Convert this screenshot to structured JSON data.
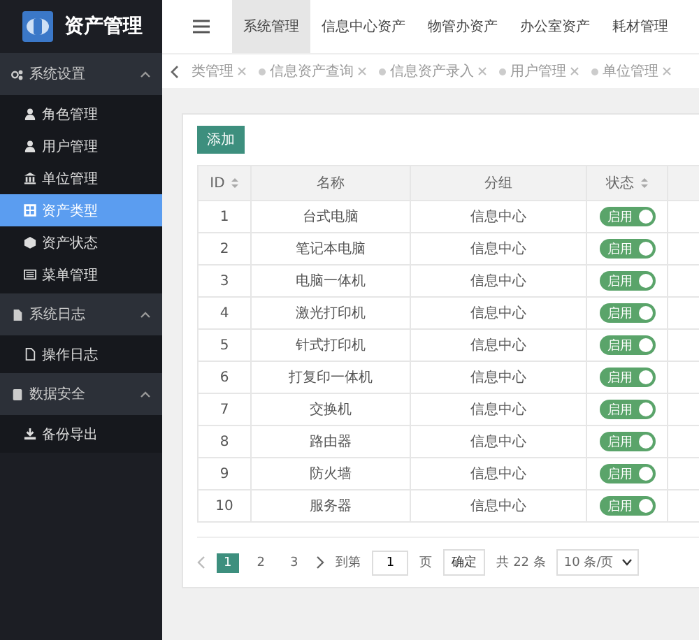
{
  "app": {
    "title": "资产管理"
  },
  "sidebar": {
    "groups": [
      {
        "label": "系统设置",
        "expanded": true,
        "items": [
          {
            "label": "角色管理",
            "selected": false
          },
          {
            "label": "用户管理",
            "selected": false
          },
          {
            "label": "单位管理",
            "selected": false
          },
          {
            "label": "资产类型",
            "selected": true
          },
          {
            "label": "资产状态",
            "selected": false
          },
          {
            "label": "菜单管理",
            "selected": false
          }
        ]
      },
      {
        "label": "系统日志",
        "expanded": true,
        "items": [
          {
            "label": "操作日志",
            "selected": false
          }
        ]
      },
      {
        "label": "数据安全",
        "expanded": true,
        "items": [
          {
            "label": "备份导出",
            "selected": false
          }
        ]
      }
    ]
  },
  "top_nav": {
    "tabs": [
      {
        "label": "系统管理",
        "selected": true
      },
      {
        "label": "信息中心资产",
        "selected": false
      },
      {
        "label": "物管办资产",
        "selected": false
      },
      {
        "label": "办公室资产",
        "selected": false
      },
      {
        "label": "耗材管理",
        "selected": false
      }
    ]
  },
  "page_tabs": [
    {
      "label": "类管理"
    },
    {
      "label": "信息资产查询"
    },
    {
      "label": "信息资产录入"
    },
    {
      "label": "用户管理"
    },
    {
      "label": "单位管理"
    }
  ],
  "toolbar": {
    "add_button": "添加"
  },
  "table": {
    "columns": [
      {
        "label": "ID",
        "sortable": true
      },
      {
        "label": "名称",
        "sortable": false
      },
      {
        "label": "分组",
        "sortable": false
      },
      {
        "label": "状态",
        "sortable": true
      }
    ],
    "rows": [
      {
        "id": "1",
        "name": "台式电脑",
        "group": "信息中心",
        "status": "启用",
        "on": true
      },
      {
        "id": "2",
        "name": "笔记本电脑",
        "group": "信息中心",
        "status": "启用",
        "on": true
      },
      {
        "id": "3",
        "name": "电脑一体机",
        "group": "信息中心",
        "status": "启用",
        "on": true
      },
      {
        "id": "4",
        "name": "激光打印机",
        "group": "信息中心",
        "status": "启用",
        "on": true
      },
      {
        "id": "5",
        "name": "针式打印机",
        "group": "信息中心",
        "status": "启用",
        "on": true
      },
      {
        "id": "6",
        "name": "打复印一体机",
        "group": "信息中心",
        "status": "启用",
        "on": true
      },
      {
        "id": "7",
        "name": "交换机",
        "group": "信息中心",
        "status": "启用",
        "on": true
      },
      {
        "id": "8",
        "name": "路由器",
        "group": "信息中心",
        "status": "启用",
        "on": true
      },
      {
        "id": "9",
        "name": "防火墙",
        "group": "信息中心",
        "status": "启用",
        "on": true
      },
      {
        "id": "10",
        "name": "服务器",
        "group": "信息中心",
        "status": "启用",
        "on": true
      }
    ]
  },
  "pagination": {
    "pages": [
      {
        "label": "1",
        "selected": true
      },
      {
        "label": "2",
        "selected": false
      },
      {
        "label": "3",
        "selected": false
      }
    ],
    "goto_label": "到第",
    "page_value": "1",
    "page_unit": "页",
    "confirm": "确定",
    "total": "共 22 条",
    "page_size": "10 条/页"
  }
}
